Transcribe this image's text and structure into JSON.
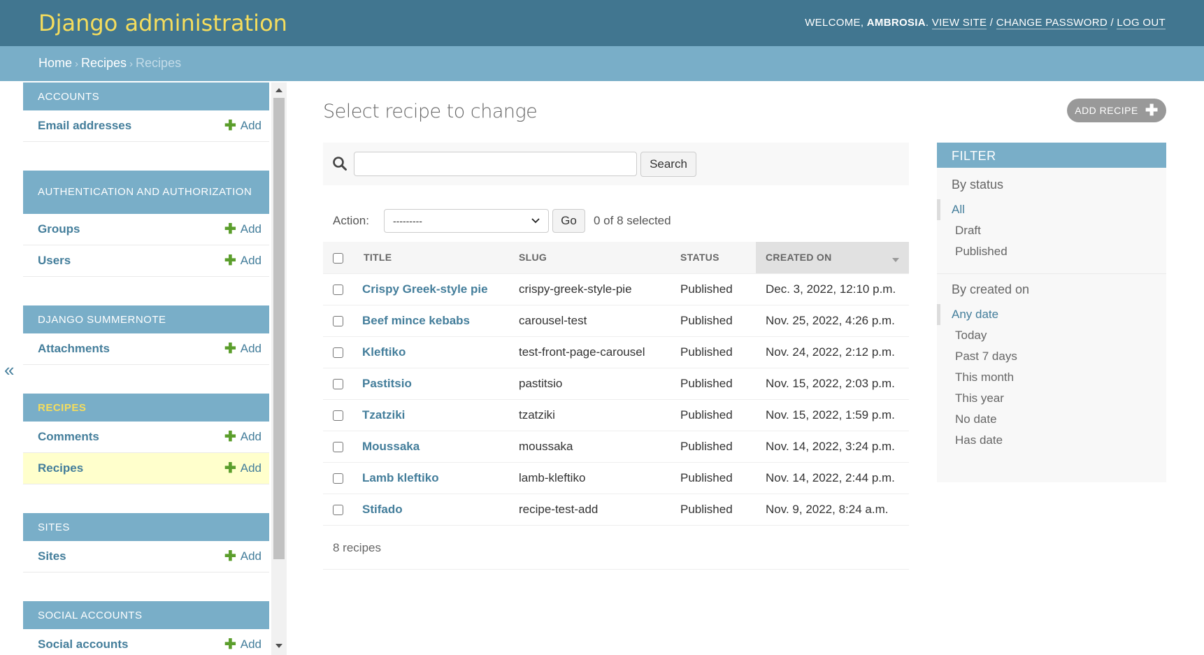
{
  "header": {
    "branding": "Django administration",
    "welcome": "Welcome,",
    "username": "Ambrosia",
    "view_site": "View site",
    "change_password": "Change password",
    "log_out": "Log out"
  },
  "breadcrumbs": {
    "home": "Home",
    "app": "Recipes",
    "current": "Recipes"
  },
  "sidebar": {
    "modules": [
      {
        "caption": "Accounts",
        "rows": [
          {
            "label": "Email addresses",
            "add": "Add"
          }
        ]
      },
      {
        "caption": "Authentication and Authorization",
        "rows": [
          {
            "label": "Groups",
            "add": "Add"
          },
          {
            "label": "Users",
            "add": "Add"
          }
        ]
      },
      {
        "caption": "Django Summernote",
        "rows": [
          {
            "label": "Attachments",
            "add": "Add"
          }
        ]
      },
      {
        "caption": "Recipes",
        "rows": [
          {
            "label": "Comments",
            "add": "Add"
          },
          {
            "label": "Recipes",
            "add": "Add"
          }
        ]
      },
      {
        "caption": "Sites",
        "rows": [
          {
            "label": "Sites",
            "add": "Add"
          }
        ]
      },
      {
        "caption": "Social Accounts",
        "rows": [
          {
            "label": "Social accounts",
            "add": "Add"
          }
        ]
      }
    ],
    "toggle": "«"
  },
  "content": {
    "title": "Select recipe to change",
    "add_button": "Add recipe",
    "search": {
      "placeholder": "",
      "value": "",
      "button": "Search"
    },
    "actions": {
      "label": "Action:",
      "selected_option": "---------",
      "go": "Go",
      "count": "0 of 8 selected"
    },
    "table": {
      "headers": [
        "Title",
        "Slug",
        "Status",
        "Created on"
      ],
      "rows": [
        {
          "title": "Crispy Greek-style pie",
          "slug": "crispy-greek-style-pie",
          "status": "Published",
          "created": "Dec. 3, 2022, 12:10 p.m."
        },
        {
          "title": "Beef mince kebabs",
          "slug": "carousel-test",
          "status": "Published",
          "created": "Nov. 25, 2022, 4:26 p.m."
        },
        {
          "title": "Kleftiko",
          "slug": "test-front-page-carousel",
          "status": "Published",
          "created": "Nov. 24, 2022, 2:12 p.m."
        },
        {
          "title": "Pastitsio",
          "slug": "pastitsio",
          "status": "Published",
          "created": "Nov. 15, 2022, 2:03 p.m."
        },
        {
          "title": "Tzatziki",
          "slug": "tzatziki",
          "status": "Published",
          "created": "Nov. 15, 2022, 1:59 p.m."
        },
        {
          "title": "Moussaka",
          "slug": "moussaka",
          "status": "Published",
          "created": "Nov. 14, 2022, 3:24 p.m."
        },
        {
          "title": "Lamb kleftiko",
          "slug": "lamb-kleftiko",
          "status": "Published",
          "created": "Nov. 14, 2022, 2:44 p.m."
        },
        {
          "title": "Stifado",
          "slug": "recipe-test-add",
          "status": "Published",
          "created": "Nov. 9, 2022, 8:24 a.m."
        }
      ]
    },
    "paginator": "8 recipes"
  },
  "filter": {
    "title": "Filter",
    "by_status": {
      "heading": "By status",
      "options": [
        "All",
        "Draft",
        "Published"
      ],
      "selected": 0
    },
    "by_created": {
      "heading": "By created on",
      "options": [
        "Any date",
        "Today",
        "Past 7 days",
        "This month",
        "This year",
        "No date",
        "Has date"
      ],
      "selected": 0
    }
  },
  "colors": {
    "header_bg": "#417690",
    "branding": "#f5dd5d",
    "breadcrumbs_bg": "#79aec8",
    "link": "#447e9b",
    "add_plus": "#5b9e2c",
    "current_row": "#ffffcc"
  }
}
